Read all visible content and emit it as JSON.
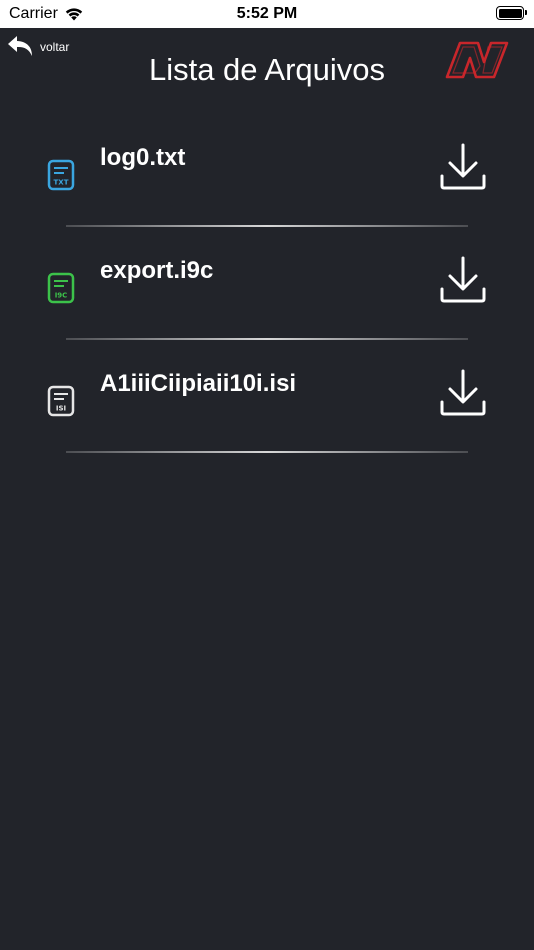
{
  "status_bar": {
    "carrier": "Carrier",
    "time": "5:52 PM",
    "battery_level": 1.0
  },
  "header": {
    "back_label": "voltar",
    "title": "Lista de Arquivos"
  },
  "files": [
    {
      "name": "log0.txt",
      "type_label": "TXT",
      "icon_color": "#3aa6e0"
    },
    {
      "name": "export.i9c",
      "type_label": "I9C",
      "icon_color": "#3cc24a"
    },
    {
      "name": "A1iiiCiipiaii10i.isi",
      "type_label": "ISI",
      "icon_color": "#e6e6e6"
    }
  ],
  "colors": {
    "background": "#22242a",
    "logo_red": "#c8262b",
    "text": "#ffffff"
  }
}
